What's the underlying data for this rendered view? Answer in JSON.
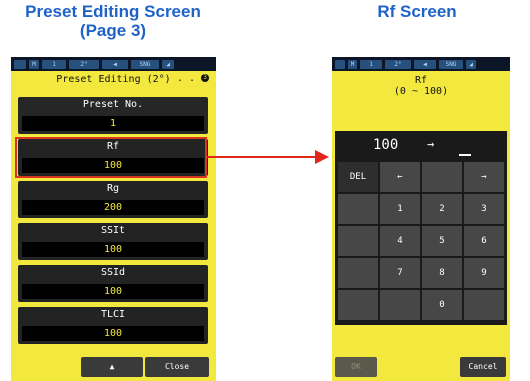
{
  "captions": {
    "left_line1": "Preset Editing Screen",
    "left_line2": "(Page 3)",
    "right": "Rf Screen"
  },
  "left_screen": {
    "title": "Preset Editing (2°)",
    "dots": ". .",
    "page_indicator": "3",
    "preset": {
      "label": "Preset No.",
      "value": "1"
    },
    "fields": [
      {
        "label": "Rf",
        "value": "100"
      },
      {
        "label": "Rg",
        "value": "200"
      },
      {
        "label": "SSIt",
        "value": "100"
      },
      {
        "label": "SSId",
        "value": "100"
      },
      {
        "label": "TLCI",
        "value": "100"
      }
    ],
    "up_label": "▲",
    "close_label": "Close"
  },
  "right_screen": {
    "title": "Rf",
    "range": "(0 ~ 100)",
    "display_value": "100",
    "display_arrow": "→",
    "keys": [
      "DEL",
      "←",
      "",
      "→",
      "",
      "1",
      "2",
      "3",
      "",
      "4",
      "5",
      "6",
      "",
      "7",
      "8",
      "9",
      "",
      "",
      "0",
      ""
    ],
    "ok_label": "OK",
    "cancel_label": "Cancel"
  },
  "status_bar": [
    "M",
    "1",
    "2°",
    "◀",
    "SNG",
    "◢"
  ],
  "colors": {
    "caption_blue": "#1f63c9",
    "screen_yellow": "#f3e83e",
    "arrow_red": "#e0261b"
  }
}
